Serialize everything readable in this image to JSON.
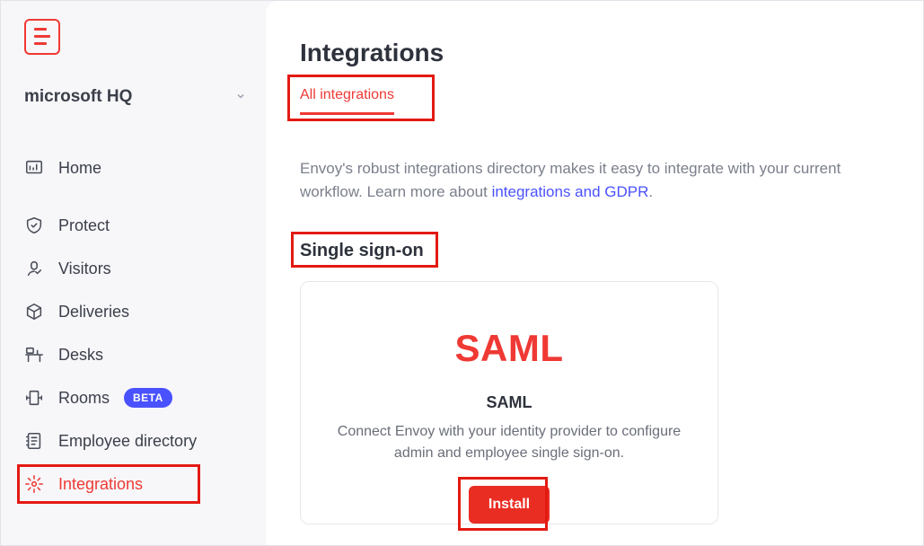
{
  "workspace": {
    "name": "microsoft HQ"
  },
  "sidebar": {
    "items": [
      {
        "label": "Home"
      },
      {
        "label": "Protect"
      },
      {
        "label": "Visitors"
      },
      {
        "label": "Deliveries"
      },
      {
        "label": "Desks"
      },
      {
        "label": "Rooms",
        "badge": "BETA"
      },
      {
        "label": "Employee directory"
      },
      {
        "label": "Integrations"
      }
    ]
  },
  "page": {
    "title": "Integrations",
    "tab_all": "All integrations",
    "description_prefix": "Envoy's robust integrations directory makes it easy to integrate with your current workflow. Learn more about ",
    "description_link": "integrations and GDPR",
    "description_suffix": "."
  },
  "section": {
    "title": "Single sign-on",
    "card": {
      "logo_text": "SAML",
      "title": "SAML",
      "description": "Connect Envoy with your identity provider to configure admin and employee single sign-on.",
      "install_label": "Install"
    }
  }
}
